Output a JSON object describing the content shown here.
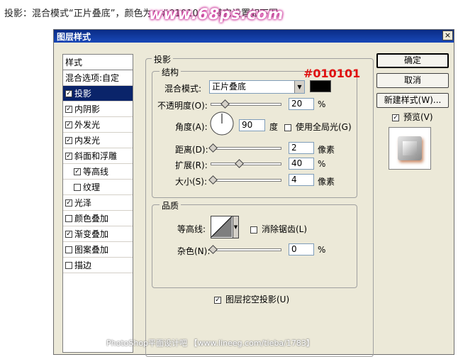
{
  "caption": "投影：混合模式“正片叠底”，颜色为：#010101，其它设置如下图。",
  "watermark": "www.68ps.com",
  "dialog": {
    "title": "图层样式",
    "close_glyph": "×"
  },
  "left_panel": {
    "header": "样式",
    "blend_options": "混合选项:自定",
    "items": [
      {
        "label": "投影",
        "checked": true,
        "selected": true
      },
      {
        "label": "内阴影",
        "checked": true
      },
      {
        "label": "外发光",
        "checked": true
      },
      {
        "label": "内发光",
        "checked": true
      },
      {
        "label": "斜面和浮雕",
        "checked": true
      },
      {
        "label": "等高线",
        "checked": true,
        "indent": true
      },
      {
        "label": "纹理",
        "checked": false,
        "indent": true
      },
      {
        "label": "光泽",
        "checked": true
      },
      {
        "label": "颜色叠加",
        "checked": false
      },
      {
        "label": "渐变叠加",
        "checked": true
      },
      {
        "label": "图案叠加",
        "checked": false
      },
      {
        "label": "描边",
        "checked": false
      }
    ]
  },
  "shadow": {
    "group_title": "投影",
    "structure": {
      "title": "结构",
      "blend_mode_label": "混合模式:",
      "blend_mode_value": "正片叠底",
      "color": "#010101",
      "color_annotation": "#010101",
      "opacity_label": "不透明度(O):",
      "opacity_value": "20",
      "opacity_unit": "%",
      "angle_label": "角度(A):",
      "angle_value": "90",
      "angle_unit": "度",
      "global_light_label": "使用全局光(G)",
      "distance_label": "距离(D):",
      "distance_value": "2",
      "distance_unit": "像素",
      "spread_label": "扩展(R):",
      "spread_value": "40",
      "spread_unit": "%",
      "size_label": "大小(S):",
      "size_value": "4",
      "size_unit": "像素"
    },
    "quality": {
      "title": "品质",
      "contour_label": "等高线:",
      "antialias_label": "消除锯齿(L)",
      "noise_label": "杂色(N):",
      "noise_value": "0",
      "noise_unit": "%"
    },
    "knockout_label": "图层挖空投影(U)"
  },
  "buttons": {
    "ok": "确定",
    "cancel": "取消",
    "new_style": "新建样式(W)...",
    "preview": "预览(V)"
  },
  "footer": "PhotoShop平面设计吧 【www.lineeg.com/tieba/1783】"
}
